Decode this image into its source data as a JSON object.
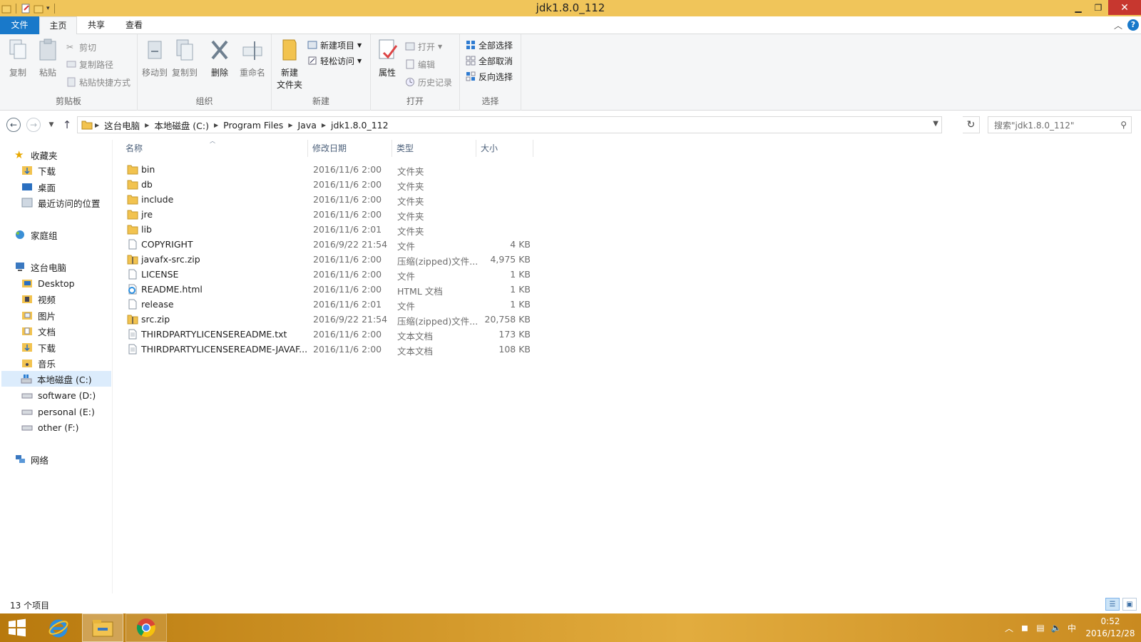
{
  "window": {
    "title": "jdk1.8.0_112"
  },
  "ribbon_tabs": {
    "file": "文件",
    "home": "主页",
    "share": "共享",
    "view": "查看"
  },
  "ribbon": {
    "clipboard": {
      "label": "剪贴板",
      "copy": "复制",
      "paste": "粘贴",
      "cut": "剪切",
      "copy_path": "复制路径",
      "paste_shortcut": "粘贴快捷方式"
    },
    "organize": {
      "label": "组织",
      "move_to": "移动到",
      "copy_to": "复制到",
      "delete": "删除",
      "rename": "重命名"
    },
    "new": {
      "label": "新建",
      "new_folder_line1": "新建",
      "new_folder_line2": "文件夹",
      "new_item": "新建项目",
      "easy_access": "轻松访问"
    },
    "open": {
      "label": "打开",
      "properties": "属性",
      "open": "打开",
      "edit": "编辑",
      "history": "历史记录"
    },
    "select": {
      "label": "选择",
      "select_all": "全部选择",
      "select_none": "全部取消",
      "invert": "反向选择"
    }
  },
  "address": {
    "crumbs": [
      "这台电脑",
      "本地磁盘 (C:)",
      "Program Files",
      "Java",
      "jdk1.8.0_112"
    ],
    "search_placeholder": "搜索\"jdk1.8.0_112\""
  },
  "nav": {
    "favorites": "收藏夹",
    "fav_items": [
      "下载",
      "桌面",
      "最近访问的位置"
    ],
    "homegroup": "家庭组",
    "this_pc": "这台电脑",
    "pc_items": [
      "Desktop",
      "视频",
      "图片",
      "文档",
      "下载",
      "音乐",
      "本地磁盘 (C:)",
      "software (D:)",
      "personal (E:)",
      "other (F:)"
    ],
    "network": "网络"
  },
  "columns": {
    "name": "名称",
    "date": "修改日期",
    "type": "类型",
    "size": "大小"
  },
  "files": [
    {
      "name": "bin",
      "date": "2016/11/6 2:00",
      "type": "文件夹",
      "size": "",
      "icon": "folder-icon"
    },
    {
      "name": "db",
      "date": "2016/11/6 2:00",
      "type": "文件夹",
      "size": "",
      "icon": "folder-icon"
    },
    {
      "name": "include",
      "date": "2016/11/6 2:00",
      "type": "文件夹",
      "size": "",
      "icon": "folder-icon"
    },
    {
      "name": "jre",
      "date": "2016/11/6 2:00",
      "type": "文件夹",
      "size": "",
      "icon": "folder-icon"
    },
    {
      "name": "lib",
      "date": "2016/11/6 2:01",
      "type": "文件夹",
      "size": "",
      "icon": "folder-icon"
    },
    {
      "name": "COPYRIGHT",
      "date": "2016/9/22 21:54",
      "type": "文件",
      "size": "4 KB",
      "icon": "file-icon"
    },
    {
      "name": "javafx-src.zip",
      "date": "2016/11/6 2:00",
      "type": "压缩(zipped)文件...",
      "size": "4,975 KB",
      "icon": "zip-icon"
    },
    {
      "name": "LICENSE",
      "date": "2016/11/6 2:00",
      "type": "文件",
      "size": "1 KB",
      "icon": "file-icon"
    },
    {
      "name": "README.html",
      "date": "2016/11/6 2:00",
      "type": "HTML 文档",
      "size": "1 KB",
      "icon": "html-icon"
    },
    {
      "name": "release",
      "date": "2016/11/6 2:01",
      "type": "文件",
      "size": "1 KB",
      "icon": "file-icon"
    },
    {
      "name": "src.zip",
      "date": "2016/9/22 21:54",
      "type": "压缩(zipped)文件...",
      "size": "20,758 KB",
      "icon": "zip-icon"
    },
    {
      "name": "THIRDPARTYLICENSEREADME.txt",
      "date": "2016/11/6 2:00",
      "type": "文本文档",
      "size": "173 KB",
      "icon": "text-file-icon"
    },
    {
      "name": "THIRDPARTYLICENSEREADME-JAVAF...",
      "date": "2016/11/6 2:00",
      "type": "文本文档",
      "size": "108 KB",
      "icon": "text-file-icon"
    }
  ],
  "status": {
    "item_count": "13 个项目"
  },
  "taskbar": {
    "time": "0:52",
    "date": "2016/12/28",
    "ime": "中"
  },
  "colors": {
    "titlebar": "#f0c55a",
    "file_tab": "#1979ca",
    "selection": "#dcecfc",
    "taskbar": "#d49a2c"
  }
}
